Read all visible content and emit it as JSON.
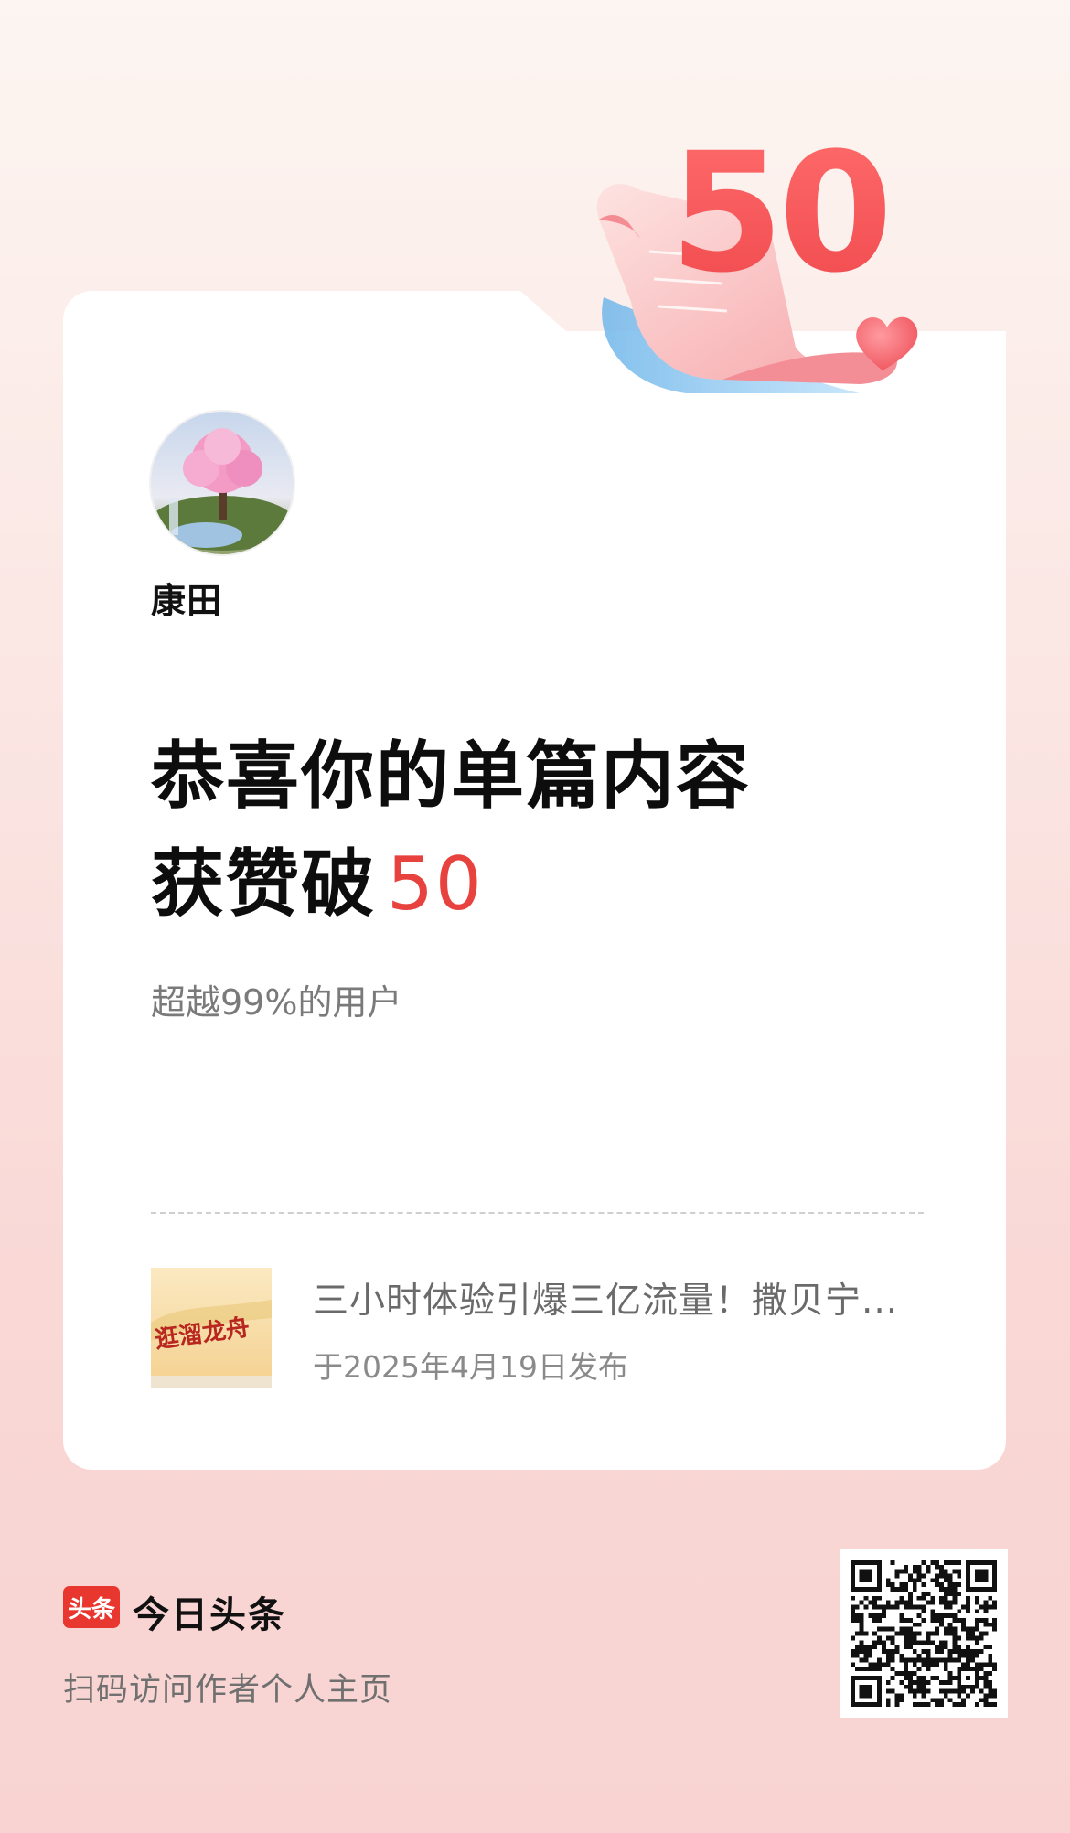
{
  "deco": {
    "badge_number": "50"
  },
  "author": {
    "name": "康田"
  },
  "headline": {
    "line1": "恭喜你的单篇内容",
    "line2_prefix": "获赞破",
    "line2_number": "50"
  },
  "subtitle": "超越99%的用户",
  "article": {
    "thumbnail_text": "逛溜龙舟",
    "title": "三小时体验引爆三亿流量！撒贝宁...",
    "date": "于2025年4月19日发布"
  },
  "footer": {
    "logo_text": "头条",
    "brand_name": "今日头条",
    "scan_text": "扫码访问作者个人主页"
  },
  "colors": {
    "accent_red": "#e8423f",
    "brand_red": "#e8372f"
  }
}
